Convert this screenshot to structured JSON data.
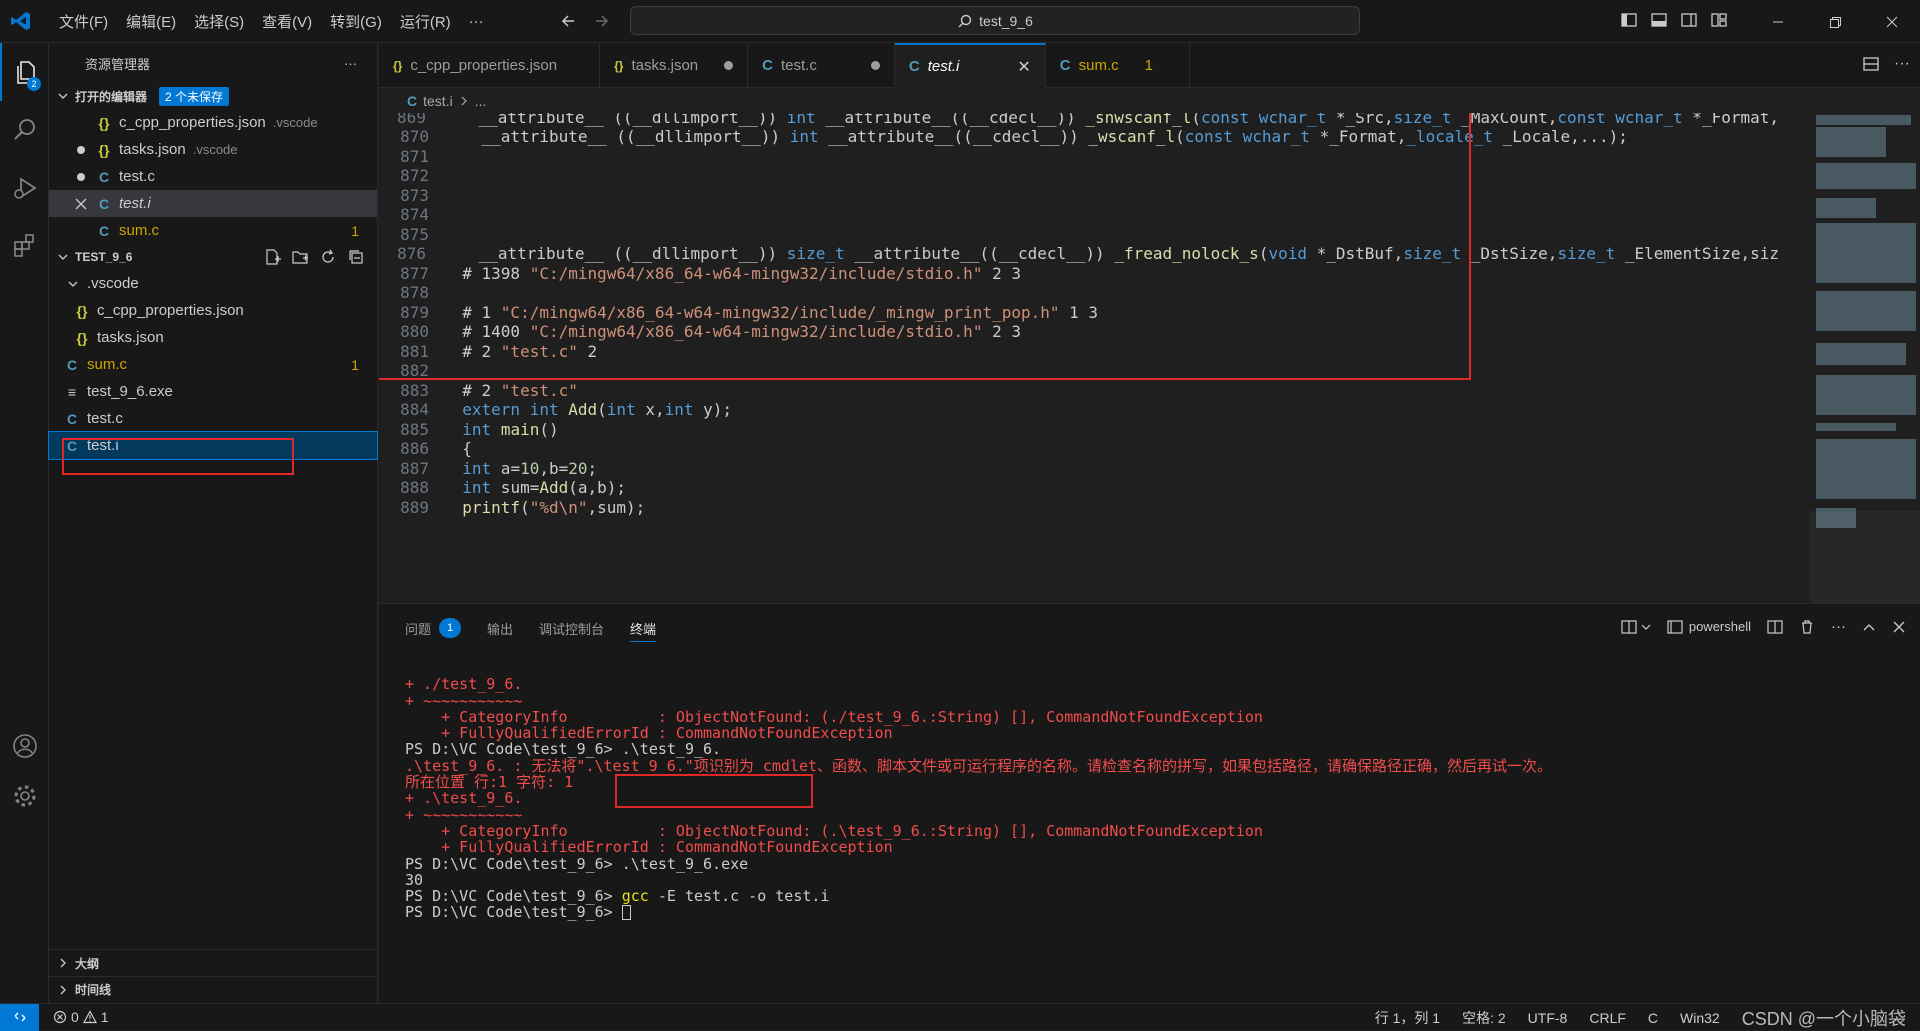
{
  "titlebar": {
    "menus": [
      "文件(F)",
      "编辑(E)",
      "选择(S)",
      "查看(V)",
      "转到(G)",
      "运行(R)",
      "···"
    ],
    "search": "test_9_6"
  },
  "activity": {
    "explorer_badge": "2"
  },
  "sidebar": {
    "title": "资源管理器",
    "more": "···",
    "open_editors": {
      "label": "打开的编辑器",
      "badge": "2 个未保存",
      "items": [
        {
          "icon": "{}",
          "name": "c_cpp_properties.json",
          "path": ".vscode"
        },
        {
          "icon": "{}",
          "name": "tasks.json",
          "path": ".vscode"
        },
        {
          "icon": "C",
          "name": "test.c",
          "path": ""
        },
        {
          "icon": "C",
          "name": "test.i",
          "path": ""
        },
        {
          "icon": "C",
          "name": "sum.c",
          "path": "",
          "count": "1"
        }
      ]
    },
    "workspace": {
      "label": "TEST_9_6",
      "folder": ".vscode",
      "folder_items": [
        "c_cpp_properties.json",
        "tasks.json"
      ],
      "items": [
        {
          "icon": "C",
          "name": "sum.c",
          "count": "1"
        },
        {
          "icon": "≡",
          "name": "test_9_6.exe"
        },
        {
          "icon": "C",
          "name": "test.c"
        },
        {
          "icon": "C",
          "name": "test.i"
        }
      ]
    },
    "outline": "大纲",
    "timeline": "时间线"
  },
  "tabs": [
    {
      "icon": "{}",
      "label": "c_cpp_properties.json"
    },
    {
      "icon": "{}",
      "label": "tasks.json"
    },
    {
      "icon": "C",
      "label": "test.c"
    },
    {
      "icon": "C",
      "label": "test.i"
    },
    {
      "icon": "C",
      "label": "sum.c",
      "count": "1"
    }
  ],
  "breadcrumb": {
    "file": "test.i",
    "rest": "..."
  },
  "editor": {
    "lines": [
      {
        "n": "869",
        "t": "    __attribute__ ((__dllimport__)) int __attribute__((__cdecl__)) _snwscanf_l(const wchar_t *_Src,size_t _MaxCount,const wchar_t *_Format,"
      },
      {
        "n": "870",
        "t": "    __attribute__ ((__dllimport__)) int __attribute__((__cdecl__)) _wscanf_l(const wchar_t *_Format,_locale_t _Locale,...);"
      },
      {
        "n": "871",
        "t": ""
      },
      {
        "n": "872",
        "t": ""
      },
      {
        "n": "873",
        "t": ""
      },
      {
        "n": "874",
        "t": ""
      },
      {
        "n": "875",
        "t": ""
      },
      {
        "n": "876",
        "t": "    __attribute__ ((__dllimport__)) size_t __attribute__((__cdecl__)) _fread_nolock_s(void *_DstBuf,size_t _DstSize,size_t _ElementSize,siz"
      },
      {
        "n": "877",
        "t": "  # 1398 \"C:/mingw64/x86_64-w64-mingw32/include/stdio.h\" 2 3"
      },
      {
        "n": "878",
        "t": ""
      },
      {
        "n": "879",
        "t": "  # 1 \"C:/mingw64/x86_64-w64-mingw32/include/_mingw_print_pop.h\" 1 3"
      },
      {
        "n": "880",
        "t": "  # 1400 \"C:/mingw64/x86_64-w64-mingw32/include/stdio.h\" 2 3"
      },
      {
        "n": "881",
        "t": "  # 2 \"test.c\" 2"
      },
      {
        "n": "882",
        "t": ""
      },
      {
        "n": "883",
        "t": "  # 2 \"test.c\""
      },
      {
        "n": "884",
        "t": "  extern int Add(int x,int y);"
      },
      {
        "n": "885",
        "t": "  int main()"
      },
      {
        "n": "886",
        "t": "  {"
      },
      {
        "n": "887",
        "t": "  int a=10,b=20;"
      },
      {
        "n": "888",
        "t": "  int sum=Add(a,b);"
      },
      {
        "n": "889",
        "t": "  printf(\"%d\\n\",sum);"
      }
    ]
  },
  "panel": {
    "tabs": [
      "问题",
      "输出",
      "调试控制台",
      "终端"
    ],
    "problems_count": "1",
    "shell": "powershell"
  },
  "terminal": {
    "lines": [
      "+ ./test_9_6.",
      "+ ~~~~~~~~~~~",
      "    + CategoryInfo          : ObjectNotFound: (./test_9_6.:String) [], CommandNotFoundException",
      "    + FullyQualifiedErrorId : CommandNotFoundException",
      "",
      "PS D:\\VC Code\\test_9_6> .\\test_9_6.",
      ".\\test_9_6. : 无法将\".\\test_9_6.\"项识别为 cmdlet、函数、脚本文件或可运行程序的名称。请检查名称的拼写，如果包括路径，请确保路径正确，然后再试一次。",
      "所在位置 行:1 字符: 1",
      "+ .\\test_9_6.",
      "+ ~~~~~~~~~~~",
      "    + CategoryInfo          : ObjectNotFound: (.\\test_9_6.:String) [], CommandNotFoundException",
      "    + FullyQualifiedErrorId : CommandNotFoundException",
      "",
      "PS D:\\VC Code\\test_9_6> .\\test_9_6.exe",
      "30",
      "PS D:\\VC Code\\test_9_6> gcc -E test.c -o test.i",
      "PS D:\\VC Code\\test_9_6> "
    ]
  },
  "statusbar": {
    "errors": "0",
    "warnings": "1",
    "position": "行 1，列 1",
    "spaces": "空格: 2",
    "encoding": "UTF-8",
    "eol": "CRLF",
    "lang": "C",
    "platform": "Win32",
    "watermark": "CSDN @一个小脑袋"
  }
}
